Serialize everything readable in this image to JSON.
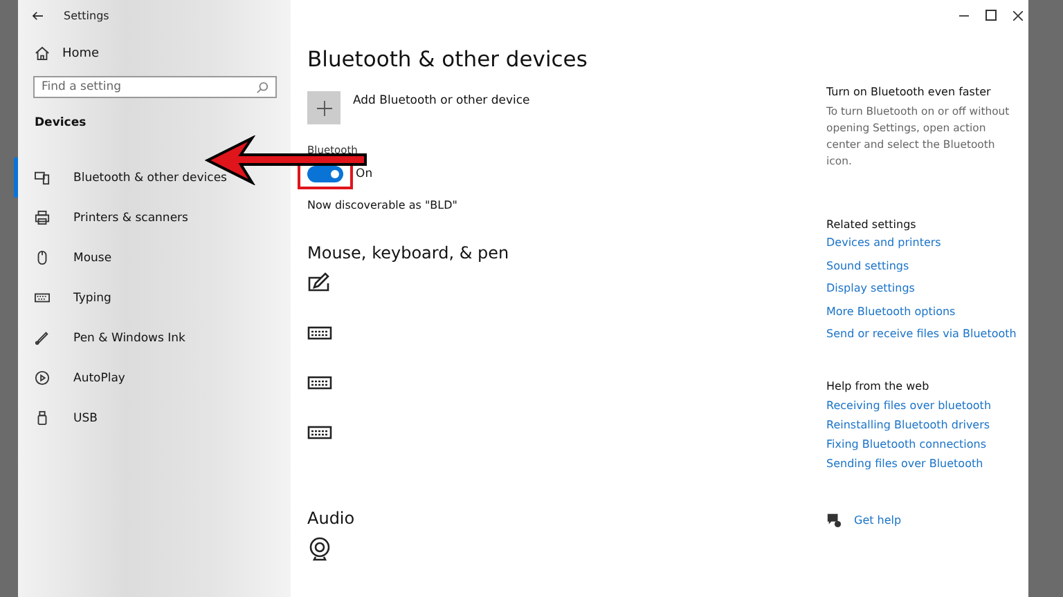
{
  "window": {
    "title": "Settings"
  },
  "sidebar": {
    "home": "Home",
    "search": {
      "placeholder": "Find a setting"
    },
    "section": "Devices",
    "items": [
      {
        "label": "Bluetooth & other devices",
        "kind": "bluetooth",
        "selected": true
      },
      {
        "label": "Printers & scanners",
        "kind": "printer",
        "selected": false
      },
      {
        "label": "Mouse",
        "kind": "mouse",
        "selected": false
      },
      {
        "label": "Typing",
        "kind": "keyboard",
        "selected": false
      },
      {
        "label": "Pen & Windows Ink",
        "kind": "pen",
        "selected": false
      },
      {
        "label": "AutoPlay",
        "kind": "autoplay",
        "selected": false
      },
      {
        "label": "USB",
        "kind": "usb",
        "selected": false
      }
    ]
  },
  "main": {
    "title": "Bluetooth & other devices",
    "add_device": "Add Bluetooth or other device",
    "bluetooth": {
      "label": "Bluetooth",
      "on": true,
      "state_text": "On"
    },
    "discoverable": "Now discoverable as \"BLD\"",
    "sections": [
      {
        "title": "Mouse, keyboard, & pen",
        "devices": [
          {
            "kind": "pen"
          },
          {
            "kind": "keyboard"
          },
          {
            "kind": "keyboard"
          },
          {
            "kind": "keyboard"
          }
        ]
      },
      {
        "title": "Audio",
        "devices": [
          {
            "kind": "webcam"
          }
        ]
      }
    ]
  },
  "side_panel": {
    "tip_title": "Turn on Bluetooth even faster",
    "tip_text": "To turn Bluetooth on or off without opening Settings, open action center and select the Bluetooth icon.",
    "related_title": "Related settings",
    "related": [
      "Devices and printers",
      "Sound settings",
      "Display settings",
      "More Bluetooth options",
      "Send or receive files via Bluetooth"
    ],
    "help_title": "Help from the web",
    "help": [
      "Receiving files over bluetooth",
      "Reinstalling Bluetooth drivers",
      "Fixing Bluetooth connections",
      "Sending files over Bluetooth"
    ],
    "get_help": "Get help"
  }
}
